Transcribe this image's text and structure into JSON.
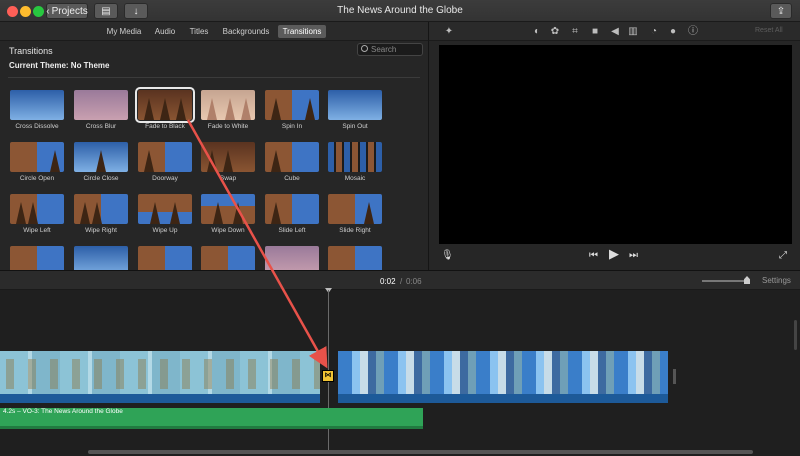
{
  "window": {
    "title": "The News Around the Globe",
    "projects_label": "Projects"
  },
  "browser": {
    "tabs": [
      {
        "label": "My Media",
        "active": false
      },
      {
        "label": "Audio",
        "active": false
      },
      {
        "label": "Titles",
        "active": false
      },
      {
        "label": "Backgrounds",
        "active": false
      },
      {
        "label": "Transitions",
        "active": true
      }
    ],
    "title": "Transitions",
    "search_placeholder": "Search",
    "theme": "Current Theme: No Theme",
    "transitions": [
      {
        "label": "Cross Dissolve"
      },
      {
        "label": "Cross Blur"
      },
      {
        "label": "Fade to Black",
        "selected": true
      },
      {
        "label": "Fade to White"
      },
      {
        "label": "Spin In"
      },
      {
        "label": "Spin Out"
      },
      {
        "label": "Circle Open"
      },
      {
        "label": "Circle Close"
      },
      {
        "label": "Doorway"
      },
      {
        "label": "Swap"
      },
      {
        "label": "Cube"
      },
      {
        "label": "Mosaic"
      },
      {
        "label": "Wipe Left"
      },
      {
        "label": "Wipe Right"
      },
      {
        "label": "Wipe Up"
      },
      {
        "label": "Wipe Down"
      },
      {
        "label": "Slide Left"
      },
      {
        "label": "Slide Right"
      }
    ]
  },
  "viewer": {
    "tool_icons": [
      "magic-wand-icon",
      "color-balance-icon",
      "color-palette-icon",
      "crop-icon",
      "camera-icon",
      "volume-icon",
      "equalizer-icon",
      "speed-icon",
      "filter-icon",
      "info-icon"
    ],
    "reset_all": "Reset All"
  },
  "timeline": {
    "current_time": "0:02",
    "separator": "/",
    "total_time": "0:06",
    "settings_label": "Settings",
    "audio_clip_label": "4.2s – VO-3: The News Around the Globe",
    "transition_icon": "⋈"
  },
  "colors": {
    "audio_clip": "#2fa357",
    "transition_marker": "#f2c434",
    "annotation_arrow": "#e8524a"
  }
}
